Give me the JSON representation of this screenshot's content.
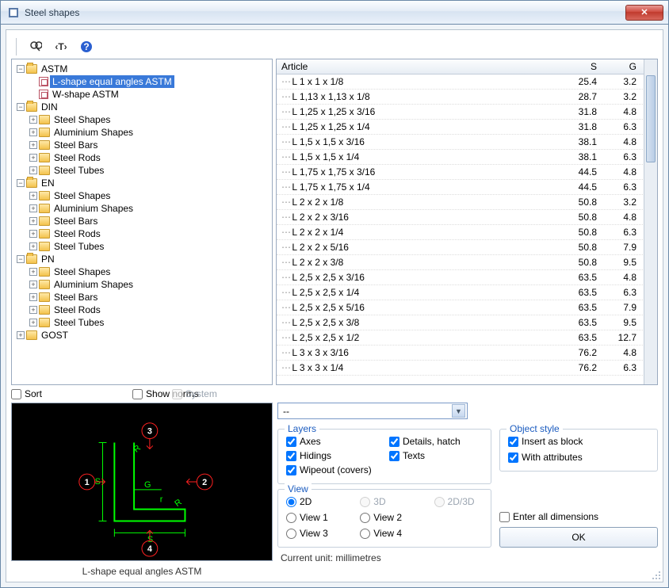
{
  "title": "Steel shapes",
  "tree": {
    "astm_label": "ASTM",
    "astm_children": [
      {
        "label": "L-shape equal angles ASTM",
        "selected": true
      },
      {
        "label": "W-shape ASTM",
        "selected": false
      }
    ],
    "standards": [
      {
        "label": "DIN",
        "children": [
          "Steel Shapes",
          "Aluminium Shapes",
          "Steel Bars",
          "Steel Rods",
          "Steel Tubes"
        ]
      },
      {
        "label": "EN",
        "children": [
          "Steel Shapes",
          "Aluminium Shapes",
          "Steel Bars",
          "Steel Rods",
          "Steel Tubes"
        ]
      },
      {
        "label": "PN",
        "children": [
          "Steel Shapes",
          "Aluminium Shapes",
          "Steel Bars",
          "Steel Rods",
          "Steel Tubes"
        ]
      }
    ],
    "gost_label": "GOST"
  },
  "table": {
    "headers": {
      "article": "Article",
      "s": "S",
      "g": "G"
    },
    "rows": [
      {
        "a": "L 1 x 1 x 1/8",
        "s": "25.4",
        "g": "3.2"
      },
      {
        "a": "L 1,13 x 1,13 x 1/8",
        "s": "28.7",
        "g": "3.2"
      },
      {
        "a": "L 1,25 x 1,25 x 3/16",
        "s": "31.8",
        "g": "4.8"
      },
      {
        "a": "L 1,25 x 1,25 x 1/4",
        "s": "31.8",
        "g": "6.3"
      },
      {
        "a": "L 1,5 x 1,5 x 3/16",
        "s": "38.1",
        "g": "4.8"
      },
      {
        "a": "L 1,5 x 1,5 x 1/4",
        "s": "38.1",
        "g": "6.3"
      },
      {
        "a": "L 1,75 x 1,75 x 3/16",
        "s": "44.5",
        "g": "4.8"
      },
      {
        "a": "L 1,75 x 1,75 x 1/4",
        "s": "44.5",
        "g": "6.3"
      },
      {
        "a": "L 2 x 2 x 1/8",
        "s": "50.8",
        "g": "3.2"
      },
      {
        "a": "L 2 x 2 x 3/16",
        "s": "50.8",
        "g": "4.8"
      },
      {
        "a": "L 2 x 2 x 1/4",
        "s": "50.8",
        "g": "6.3"
      },
      {
        "a": "L 2 x 2 x 5/16",
        "s": "50.8",
        "g": "7.9"
      },
      {
        "a": "L 2 x 2 x 3/8",
        "s": "50.8",
        "g": "9.5"
      },
      {
        "a": "L 2,5 x 2,5 x 3/16",
        "s": "63.5",
        "g": "4.8"
      },
      {
        "a": "L 2,5 x 2,5 x 1/4",
        "s": "63.5",
        "g": "6.3"
      },
      {
        "a": "L 2,5 x 2,5 x 5/16",
        "s": "63.5",
        "g": "7.9"
      },
      {
        "a": "L 2,5 x 2,5 x 3/8",
        "s": "63.5",
        "g": "9.5"
      },
      {
        "a": "L 2,5 x 2,5 x 1/2",
        "s": "63.5",
        "g": "12.7"
      },
      {
        "a": "L 3 x 3 x 3/16",
        "s": "76.2",
        "g": "4.8"
      },
      {
        "a": "L 3 x 3 x 1/4",
        "s": "76.2",
        "g": "6.3"
      }
    ]
  },
  "mid": {
    "sort": "Sort",
    "show_norms": "Show norms",
    "system": "System"
  },
  "preview_caption": "L-shape equal angles ASTM",
  "dropdown_value": "--",
  "layers": {
    "title": "Layers",
    "axes": "Axes",
    "details": "Details, hatch",
    "hidings": "Hidings",
    "texts": "Texts",
    "wipeout": "Wipeout (covers)"
  },
  "view": {
    "title": "View",
    "v2d": "2D",
    "v3d": "3D",
    "v2d3d": "2D/3D",
    "v1": "View 1",
    "v2": "View 2",
    "v3": "View 3",
    "v4": "View 4"
  },
  "obj_style": {
    "title": "Object style",
    "insert": "Insert as block",
    "attrs": "With attributes"
  },
  "enter_dims": "Enter all dimensions",
  "ok": "OK",
  "current_unit": "Current unit: millimetres"
}
